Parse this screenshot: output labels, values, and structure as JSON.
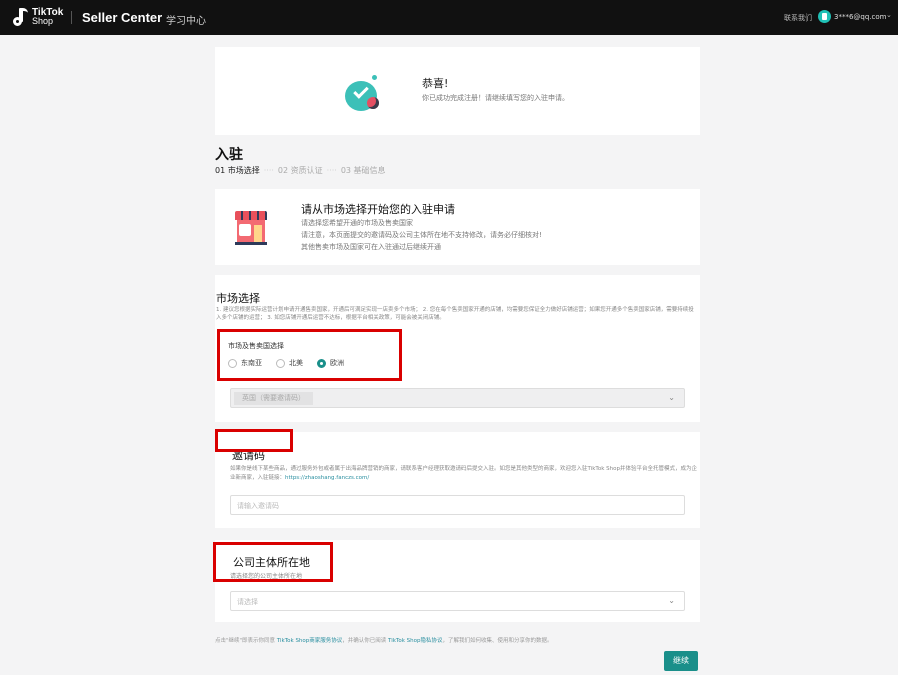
{
  "topbar": {
    "logo_line1": "TikTok",
    "logo_line2": "Shop",
    "brand": "Seller Center",
    "learn": "学习中心",
    "contact": "联系我们",
    "account": "3***6@qq.com"
  },
  "success": {
    "title": "恭喜!",
    "subtitle": "你已成功完成注册！请继续填写您的入驻申请。"
  },
  "page_title": "入驻",
  "steps": [
    "01 市场选择",
    "02 资质认证",
    "03 基础信息"
  ],
  "intro": {
    "title": "请从市场选择开始您的入驻申请",
    "lines": [
      "请选择您希望开通的市场及售卖国家",
      "请注意，本页面提交的邀请码及公司主体所在地不支持修改，请务必仔细核对!",
      "其他售卖市场及国家可在入驻通过后继续开通"
    ]
  },
  "market": {
    "title": "市场选择",
    "description": "1. 建议您根据实际运营计划申请开通售卖国家，开通后可满足实现一店卖多个市场；  2. 您在每个售卖国家开通的店铺，均需要您保证全力做好店铺运营；如果您开通多个售卖国家店铺，需要持续投入多个店铺的运营；  3. 如您店铺开通后运营不达标，根据平台相关政策，可能会被关闭店铺。",
    "select_label": "市场及售卖国选择",
    "options": [
      {
        "label": "东南亚",
        "checked": false
      },
      {
        "label": "北美",
        "checked": false
      },
      {
        "label": "欧洲",
        "checked": true
      }
    ],
    "country_tag": "英国（需要邀请码）"
  },
  "invite": {
    "title": "邀请码",
    "description": "如果你是线下某些商品，通过服务外包或者属于出海品牌营销的商家，请联系客户经理获取邀请码后提交入驻。如您是其他类型的商家，欢迎您入驻TikTok Shop并体验平台全托管模式，成为企业新商家，入驻链接：",
    "link": "https://zhaoshang.fanczs.com/",
    "placeholder": "请输入邀请码"
  },
  "company": {
    "title": "公司主体所在地",
    "subtitle": "请选择您的公司主体所在地",
    "placeholder": "请选择"
  },
  "footer": {
    "prefix": "点击\"继续\"即表示你同意 ",
    "link1": "TikTok Shop商家服务协议",
    "middle": "，并确认你已阅读 ",
    "link2": "TikTok Shop隐私协议",
    "suffix": "，了解我们如何收集、使用和分享你的数据。"
  },
  "next_button": "继续",
  "colors": {
    "accent": "#1a8f8a",
    "highlight_box": "#d90000",
    "topbar": "#111111"
  }
}
